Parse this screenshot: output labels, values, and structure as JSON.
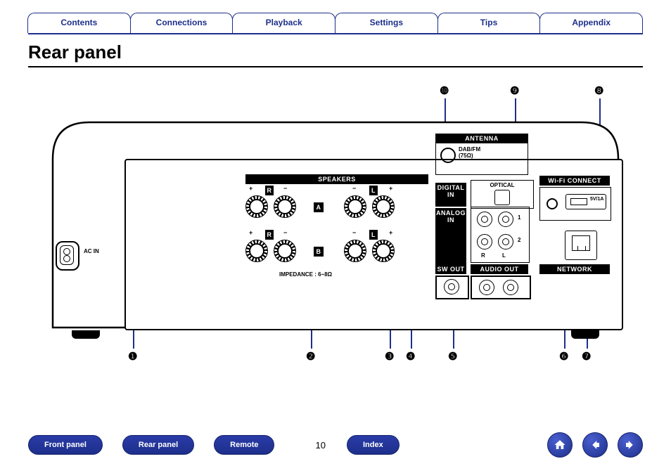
{
  "nav": {
    "tabs": [
      "Contents",
      "Connections",
      "Playback",
      "Settings",
      "Tips",
      "Appendix"
    ]
  },
  "heading": "Rear panel",
  "page_number": "10",
  "bottom_links": {
    "front_panel": "Front panel",
    "rear_panel": "Rear panel",
    "remote": "Remote",
    "index": "Index"
  },
  "panel_labels": {
    "ac_in": "AC IN",
    "speakers": "SPEAKERS",
    "speaker_a": "A",
    "speaker_b": "B",
    "impedance": "IMPEDANCE : 6~8Ω",
    "r": "R",
    "l": "L",
    "digital_in": "DIGITAL\nIN",
    "optical": "OPTICAL",
    "analog_in": "ANALOG\nIN",
    "analog_1": "1",
    "analog_2": "2",
    "sw_out": "SW OUT",
    "audio_out": "AUDIO OUT",
    "antenna": "ANTENNA",
    "dab_fm": "DAB/FM\n(75Ω)",
    "wifi_connect": "Wi-Fi CONNECT",
    "usb_power": "5V/1A",
    "network": "NETWORK"
  },
  "callouts": {
    "c1": "❶",
    "c2": "❷",
    "c3": "❸",
    "c4": "❹",
    "c5": "❺",
    "c6": "❻",
    "c7": "❼",
    "c8": "❽",
    "c9": "❾",
    "c10": "❿"
  },
  "icons": {
    "home": "home-icon",
    "prev": "arrow-left-icon",
    "next": "arrow-right-icon"
  }
}
